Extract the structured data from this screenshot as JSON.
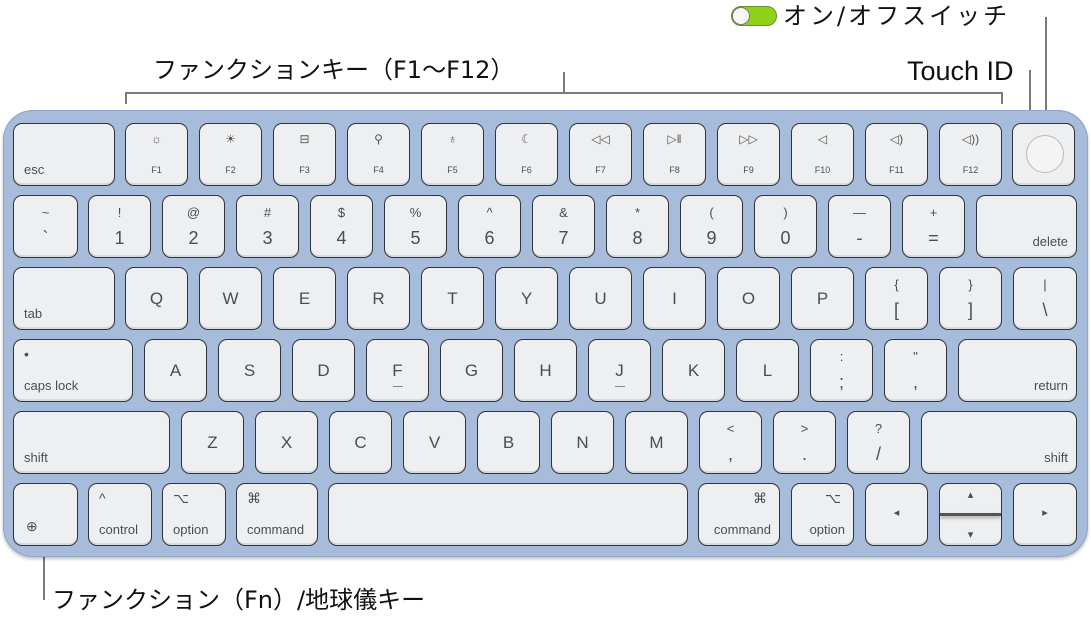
{
  "callouts": {
    "function_keys": "ファンクションキー（F1〜F12）",
    "power_switch": "オン/オフスイッチ",
    "touch_id": "Touch ID",
    "fn_globe_key": "ファンクション（Fn）/地球儀キー"
  },
  "colors": {
    "keyboard_body": "#a7bcdb",
    "key_face": "#eeeff1",
    "toggle_on": "#8fd21a"
  },
  "rows": [
    [
      {
        "bl": "esc"
      },
      {
        "icon": "brightness-down-icon",
        "label": "F1"
      },
      {
        "icon": "brightness-up-icon",
        "label": "F2"
      },
      {
        "icon": "mission-control-icon",
        "label": "F3"
      },
      {
        "icon": "search-icon",
        "label": "F4"
      },
      {
        "icon": "microphone-icon",
        "label": "F5"
      },
      {
        "icon": "moon-icon",
        "label": "F6"
      },
      {
        "icon": "rewind-icon",
        "label": "F7"
      },
      {
        "icon": "play-pause-icon",
        "label": "F8"
      },
      {
        "icon": "fast-forward-icon",
        "label": "F9"
      },
      {
        "icon": "mute-icon",
        "label": "F10"
      },
      {
        "icon": "volume-down-icon",
        "label": "F11"
      },
      {
        "icon": "volume-up-icon",
        "label": "F12"
      },
      {
        "touch": "Touch ID"
      }
    ],
    [
      {
        "top": "~",
        "bottom": "`"
      },
      {
        "top": "!",
        "bottom": "1"
      },
      {
        "top": "@",
        "bottom": "2"
      },
      {
        "top": "#",
        "bottom": "3"
      },
      {
        "top": "$",
        "bottom": "4"
      },
      {
        "top": "%",
        "bottom": "5"
      },
      {
        "top": "^",
        "bottom": "6"
      },
      {
        "top": "&",
        "bottom": "7"
      },
      {
        "top": "*",
        "bottom": "8"
      },
      {
        "top": "(",
        "bottom": "9"
      },
      {
        "top": ")",
        "bottom": "0"
      },
      {
        "top": "—",
        "bottom": "-"
      },
      {
        "top": "+",
        "bottom": "="
      },
      {
        "br": "delete"
      }
    ],
    [
      {
        "bl": "tab"
      },
      {
        "letter": "Q"
      },
      {
        "letter": "W"
      },
      {
        "letter": "E"
      },
      {
        "letter": "R"
      },
      {
        "letter": "T"
      },
      {
        "letter": "Y"
      },
      {
        "letter": "U"
      },
      {
        "letter": "I"
      },
      {
        "letter": "O"
      },
      {
        "letter": "P"
      },
      {
        "top": "{",
        "bottom": "["
      },
      {
        "top": "}",
        "bottom": "]"
      },
      {
        "top": "|",
        "bottom": "\\"
      }
    ],
    [
      {
        "bl": "caps lock",
        "tl": "•"
      },
      {
        "letter": "A"
      },
      {
        "letter": "S"
      },
      {
        "letter": "D"
      },
      {
        "letter": "F",
        "bump": true
      },
      {
        "letter": "G"
      },
      {
        "letter": "H"
      },
      {
        "letter": "J",
        "bump": true
      },
      {
        "letter": "K"
      },
      {
        "letter": "L"
      },
      {
        "top": ":",
        "bottom": ";"
      },
      {
        "top": "\"",
        "bottom": ","
      },
      {
        "br": "return"
      }
    ],
    [
      {
        "bl": "shift"
      },
      {
        "letter": "Z"
      },
      {
        "letter": "X"
      },
      {
        "letter": "C"
      },
      {
        "letter": "V"
      },
      {
        "letter": "B"
      },
      {
        "letter": "N"
      },
      {
        "letter": "M"
      },
      {
        "top": "<",
        "bottom": ","
      },
      {
        "top": ">",
        "bottom": "."
      },
      {
        "top": "?",
        "bottom": "/"
      },
      {
        "br": "shift"
      }
    ],
    [
      {
        "globe": "globe-icon"
      },
      {
        "tl": "^",
        "bl": "control"
      },
      {
        "tl": "⌥",
        "bl": "option"
      },
      {
        "tl": "⌘",
        "bl": "command"
      },
      {
        "space": true
      },
      {
        "tr": "⌘",
        "br": "command"
      },
      {
        "tr": "⌥",
        "br": "option"
      },
      {
        "arrow": "◂"
      },
      {
        "updown": [
          "▴",
          "▾"
        ]
      },
      {
        "arrow": "▸"
      }
    ]
  ]
}
